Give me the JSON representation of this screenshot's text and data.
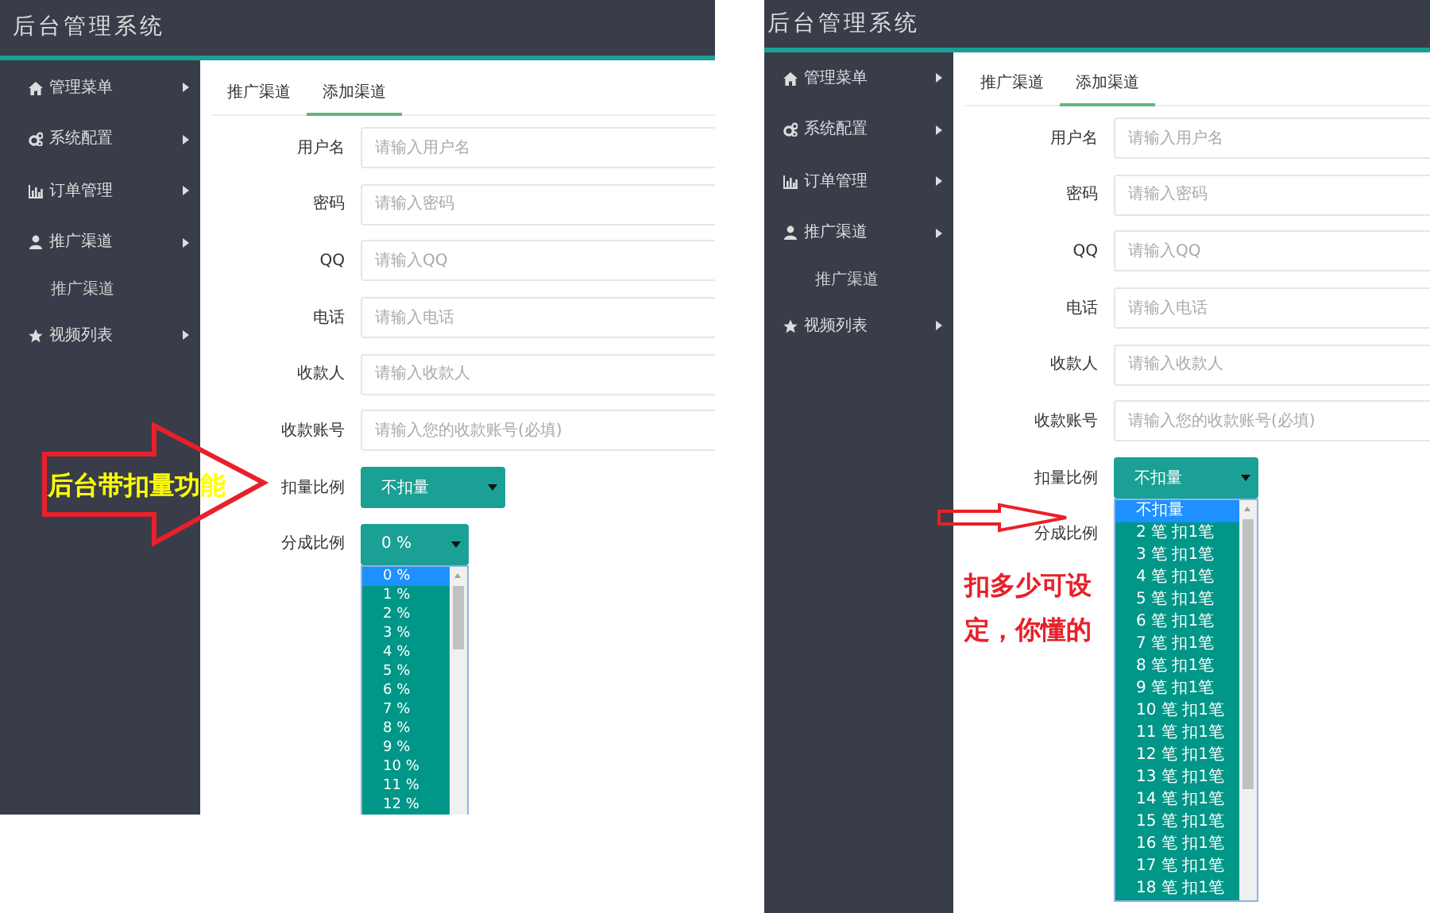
{
  "panels": [
    {
      "header": {
        "title": "后台管理系统"
      },
      "sidebar": [
        {
          "label": "管理菜单"
        },
        {
          "label": "系统配置"
        },
        {
          "label": "订单管理"
        },
        {
          "label": "推广渠道",
          "children": [
            {
              "label": "推广渠道"
            }
          ]
        },
        {
          "label": "视频列表"
        }
      ],
      "tabs": [
        {
          "label": "推广渠道",
          "selected": false
        },
        {
          "label": "添加渠道",
          "selected": true
        }
      ],
      "fields": [
        {
          "label": "用户名",
          "placeholder": "请输入用户名"
        },
        {
          "label": "密码",
          "placeholder": "请输入密码"
        },
        {
          "label": "QQ",
          "placeholder": "请输入QQ"
        },
        {
          "label": "电话",
          "placeholder": "请输入电话"
        },
        {
          "label": "收款人",
          "placeholder": "请输入收款人"
        },
        {
          "label": "收款账号",
          "placeholder": "请输入您的收款账号(必填)"
        }
      ],
      "selects": [
        {
          "label": "扣量比例",
          "value": "不扣量",
          "open": false
        },
        {
          "label": "分成比例",
          "value": "0 %",
          "open": true,
          "options": [
            {
              "label": "0 %",
              "selected": true
            },
            {
              "label": "1 %",
              "selected": false
            },
            {
              "label": "2 %",
              "selected": false
            },
            {
              "label": "3 %",
              "selected": false
            },
            {
              "label": "4 %",
              "selected": false
            },
            {
              "label": "5 %",
              "selected": false
            },
            {
              "label": "6 %",
              "selected": false
            },
            {
              "label": "7 %",
              "selected": false
            },
            {
              "label": "8 %",
              "selected": false
            },
            {
              "label": "9 %",
              "selected": false
            },
            {
              "label": "10 %",
              "selected": false
            },
            {
              "label": "11 %",
              "selected": false
            },
            {
              "label": "12 %",
              "selected": false
            }
          ]
        }
      ],
      "annotation": {
        "kind": "block-arrow",
        "text": "后台带扣量功能"
      }
    },
    {
      "header": {
        "title": "后台管理系统"
      },
      "sidebar": [
        {
          "label": "管理菜单"
        },
        {
          "label": "系统配置"
        },
        {
          "label": "订单管理"
        },
        {
          "label": "推广渠道",
          "children": [
            {
              "label": "推广渠道"
            }
          ]
        },
        {
          "label": "视频列表"
        }
      ],
      "tabs": [
        {
          "label": "推广渠道",
          "selected": false
        },
        {
          "label": "添加渠道",
          "selected": true
        }
      ],
      "fields": [
        {
          "label": "用户名",
          "placeholder": "请输入用户名"
        },
        {
          "label": "密码",
          "placeholder": "请输入密码"
        },
        {
          "label": "QQ",
          "placeholder": "请输入QQ"
        },
        {
          "label": "电话",
          "placeholder": "请输入电话"
        },
        {
          "label": "收款人",
          "placeholder": "请输入收款人"
        },
        {
          "label": "收款账号",
          "placeholder": "请输入您的收款账号(必填)"
        }
      ],
      "selects": [
        {
          "label": "扣量比例",
          "value": "不扣量",
          "open": true,
          "options": [
            {
              "label": "不扣量",
              "selected": true
            },
            {
              "label": "2 笔 扣1笔",
              "selected": false
            },
            {
              "label": "3 笔 扣1笔",
              "selected": false
            },
            {
              "label": "4 笔 扣1笔",
              "selected": false
            },
            {
              "label": "5 笔 扣1笔",
              "selected": false
            },
            {
              "label": "6 笔 扣1笔",
              "selected": false
            },
            {
              "label": "7 笔 扣1笔",
              "selected": false
            },
            {
              "label": "8 笔 扣1笔",
              "selected": false
            },
            {
              "label": "9 笔 扣1笔",
              "selected": false
            },
            {
              "label": "10 笔 扣1笔",
              "selected": false
            },
            {
              "label": "11 笔 扣1笔",
              "selected": false
            },
            {
              "label": "12 笔 扣1笔",
              "selected": false
            },
            {
              "label": "13 笔 扣1笔",
              "selected": false
            },
            {
              "label": "14 笔 扣1笔",
              "selected": false
            },
            {
              "label": "15 笔 扣1笔",
              "selected": false
            },
            {
              "label": "16 笔 扣1笔",
              "selected": false
            },
            {
              "label": "17 笔 扣1笔",
              "selected": false
            },
            {
              "label": "18 笔 扣1笔",
              "selected": false
            }
          ]
        },
        {
          "label": "分成比例",
          "open": false
        }
      ],
      "annotation": {
        "kind": "line-arrow",
        "text": "扣多少可设定，你懂的"
      }
    }
  ]
}
